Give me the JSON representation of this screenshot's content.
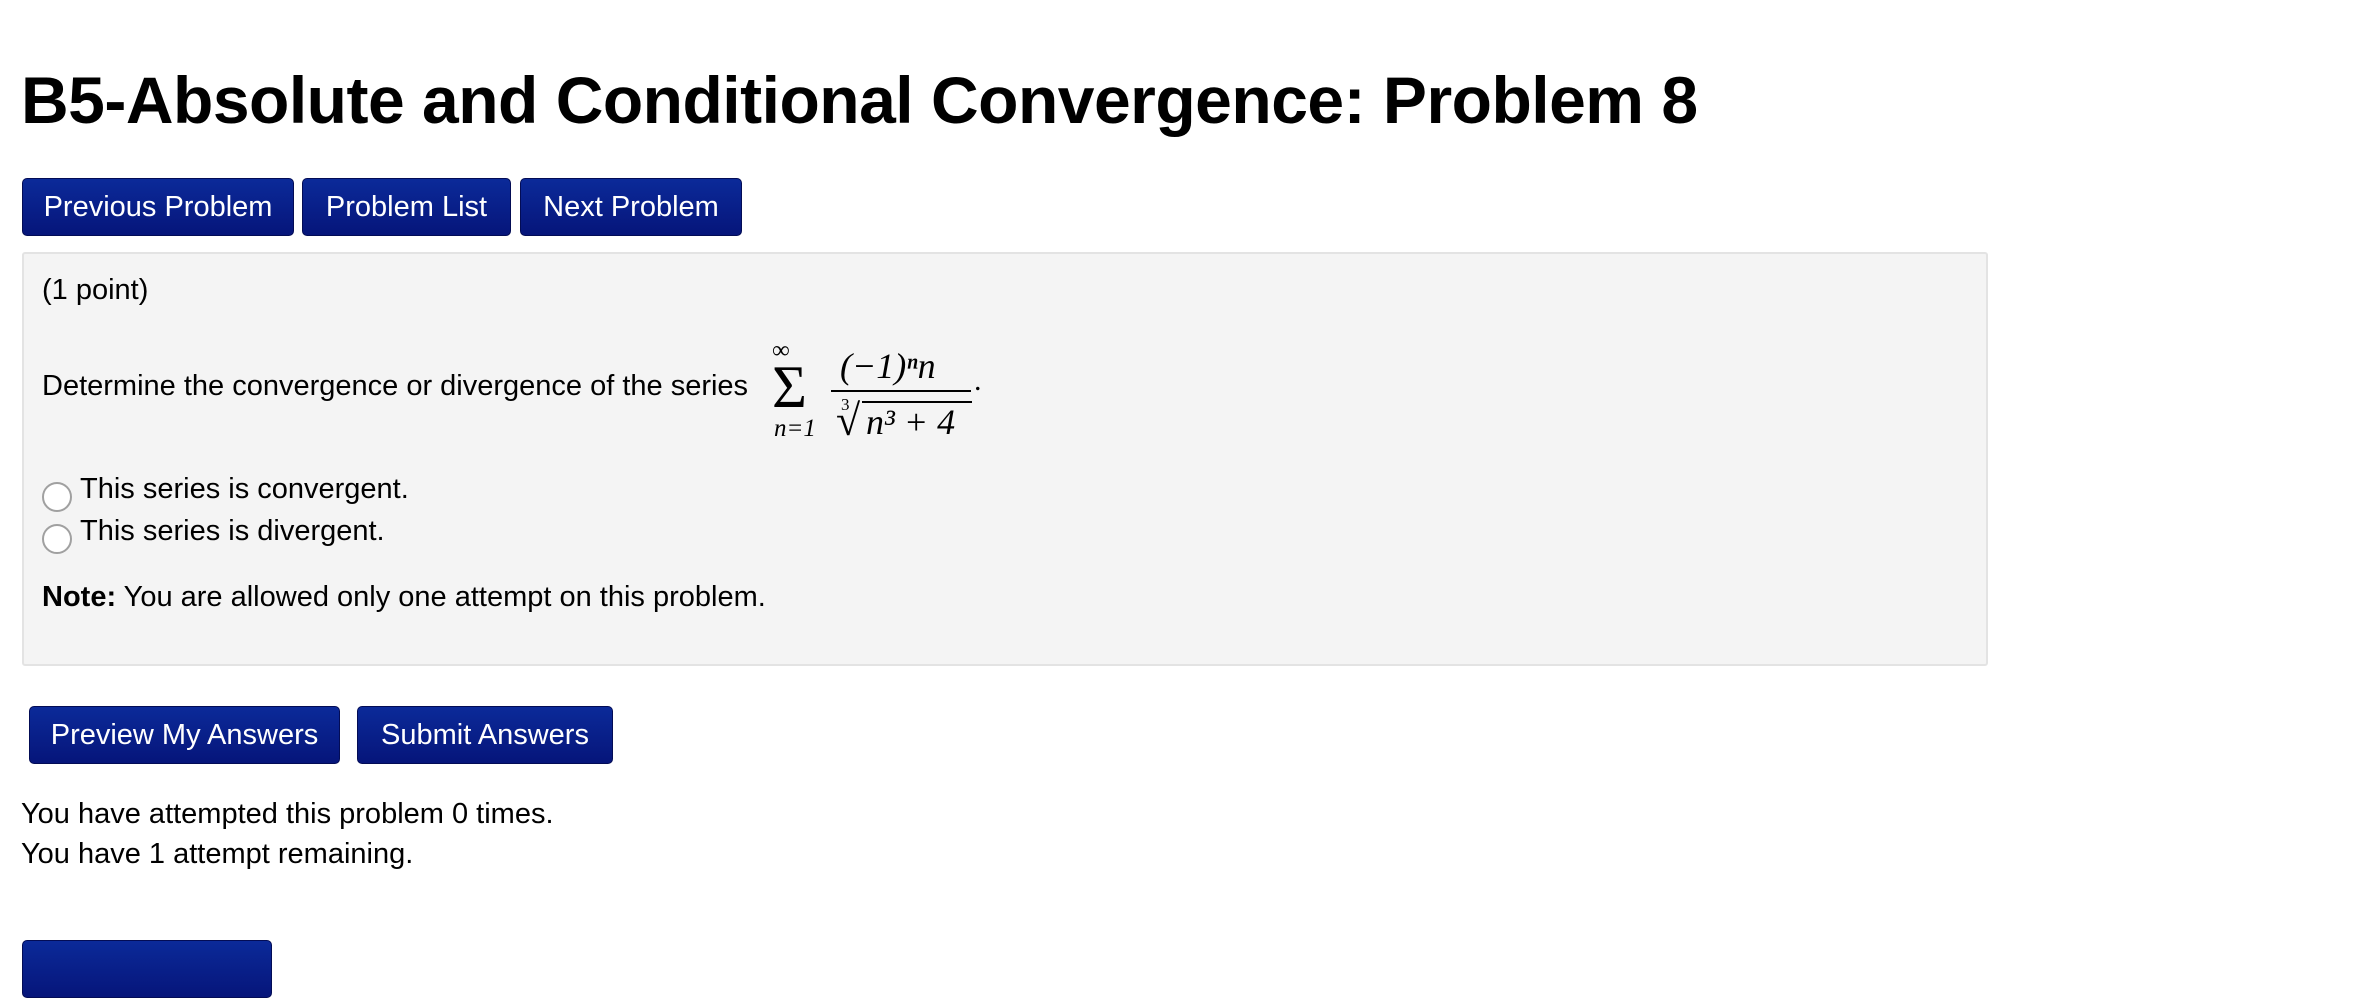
{
  "page": {
    "title": "B5-Absolute and Conditional Convergence: Problem 8"
  },
  "nav": {
    "previous_label": "Previous Problem",
    "list_label": "Problem List",
    "next_label": "Next Problem"
  },
  "problem": {
    "points": "(1 point)",
    "question": "Determine the convergence or divergence of the series",
    "formula": {
      "upper_limit": "∞",
      "sum_symbol": "Σ",
      "lower_limit": "n=1",
      "numerator": "(−1)ⁿn",
      "root_index": "3",
      "radical": "√",
      "denominator": "n³ + 4",
      "terminator": "."
    },
    "options": [
      {
        "label": "This series is convergent.",
        "selected": false
      },
      {
        "label": "This series is divergent.",
        "selected": false
      }
    ],
    "note_label": "Note:",
    "note_text": " You are allowed only one attempt on this problem."
  },
  "actions": {
    "preview_label": "Preview My Answers",
    "submit_label": "Submit Answers"
  },
  "status": {
    "attempted": "You have attempted this problem 0 times.",
    "remaining": "You have 1 attempt remaining."
  },
  "colors": {
    "button": "#06157a",
    "panel": "#f4f4f4",
    "panel_border": "#e3e3e3"
  }
}
